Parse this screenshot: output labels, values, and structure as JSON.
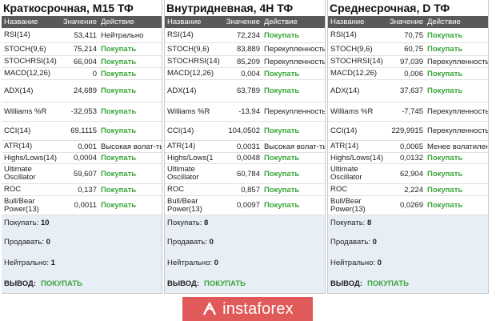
{
  "panels": [
    {
      "title": "Краткосрочная, M15 ТФ",
      "headers": [
        "Название",
        "Значение",
        "Действие"
      ],
      "rows": [
        {
          "name": "RSI(14)",
          "value": "53,411",
          "action": "Нейтрально",
          "buy": false
        },
        {
          "name": "STOCH(9,6)",
          "value": "75,214",
          "action": "Покупать",
          "buy": true
        },
        {
          "name": "STOCHRSI(14)",
          "value": "66,004",
          "action": "Покупать",
          "buy": true
        },
        {
          "name": "MACD(12,26)",
          "value": "0",
          "action": "Покупать",
          "buy": true
        },
        {
          "name": "ADX(14)",
          "value": "24,689",
          "action": "Покупать",
          "buy": true
        },
        {
          "name": "Williams %R",
          "value": "-32,053",
          "action": "Покупать",
          "buy": true
        },
        {
          "name": "CCI(14)",
          "value": "69,1115",
          "action": "Покупать",
          "buy": true
        },
        {
          "name": "ATR(14)",
          "value": "0,001",
          "action": "Высокая волат-ть",
          "buy": false
        },
        {
          "name": "Highs/Lows(14)",
          "value": "0,0004",
          "action": "Покупать",
          "buy": true
        },
        {
          "name": "Ultimate Oscillator",
          "value": "59,607",
          "action": "Покупать",
          "buy": true
        },
        {
          "name": "ROC",
          "value": "0,137",
          "action": "Покупать",
          "buy": true
        },
        {
          "name": "Bull/Bear Power(13)",
          "value": "0,0011",
          "action": "Покупать",
          "buy": true
        }
      ],
      "summary": {
        "buy_label": "Покупать:",
        "buy_count": "10",
        "sell_label": "Продавать:",
        "sell_count": "0",
        "neutral_label": "Нейтрально:",
        "neutral_count": "1",
        "verdict_label": "ВЫВОД:",
        "verdict": "ПОКУПАТЬ"
      }
    },
    {
      "title": "Внутридневная, 4Н ТФ",
      "headers": [
        "Название",
        "Значение",
        "Действие"
      ],
      "rows": [
        {
          "name": "RSI(14)",
          "value": "72,234",
          "action": "Покупать",
          "buy": true
        },
        {
          "name": "STOCH(9,6)",
          "value": "83,889",
          "action": "Перекупленность",
          "buy": false
        },
        {
          "name": "STOCHRSI(14)",
          "value": "85,209",
          "action": "Перекупленность",
          "buy": false
        },
        {
          "name": "MACD(12,26)",
          "value": "0,004",
          "action": "Покупать",
          "buy": true
        },
        {
          "name": "ADX(14)",
          "value": "63,789",
          "action": "Покупать",
          "buy": true
        },
        {
          "name": "Williams %R",
          "value": "-13,94",
          "action": "Перекупленность",
          "buy": false
        },
        {
          "name": "CCI(14)",
          "value": "104,0502",
          "action": "Покупать",
          "buy": true
        },
        {
          "name": "ATR(14)",
          "value": "0,0031",
          "action": "Высокая волат-ть",
          "buy": false
        },
        {
          "name": "Highs/Lows(1",
          "value": "0,0048",
          "action": "Покупать",
          "buy": true
        },
        {
          "name": "Ultimate Oscillator",
          "value": "60,784",
          "action": "Покупать",
          "buy": true
        },
        {
          "name": "ROC",
          "value": "0,857",
          "action": "Покупать",
          "buy": true
        },
        {
          "name": "Bull/Bear Power(13)",
          "value": "0,0097",
          "action": "Покупать",
          "buy": true
        }
      ],
      "summary": {
        "buy_label": "Покупать:",
        "buy_count": "8",
        "sell_label": "Продавать:",
        "sell_count": "0",
        "neutral_label": "Нейтрально:",
        "neutral_count": "0",
        "verdict_label": "ВЫВОД:",
        "verdict": "ПОКУПАТЬ"
      }
    },
    {
      "title": "Среднесрочная, D ТФ",
      "headers": [
        "Название",
        "Значение",
        "Действие"
      ],
      "rows": [
        {
          "name": "RSI(14)",
          "value": "70,75",
          "action": "Покупать",
          "buy": true
        },
        {
          "name": "STOCH(9,6)",
          "value": "60,75",
          "action": "Покупать",
          "buy": true
        },
        {
          "name": "STOCHRSI(14)",
          "value": "97,039",
          "action": "Перекупленность",
          "buy": false
        },
        {
          "name": "MACD(12,26)",
          "value": "0,006",
          "action": "Покупать",
          "buy": true
        },
        {
          "name": "ADX(14)",
          "value": "37,637",
          "action": "Покупать",
          "buy": true
        },
        {
          "name": "Williams %R",
          "value": "-7,745",
          "action": "Перекупленность",
          "buy": false
        },
        {
          "name": "CCI(14)",
          "value": "229,9915",
          "action": "Перекупленность",
          "buy": false
        },
        {
          "name": "ATR(14)",
          "value": "0,0065",
          "action": "Менее волатилен",
          "buy": false
        },
        {
          "name": "Highs/Lows(14)",
          "value": "0,0132",
          "action": "Покупать",
          "buy": true
        },
        {
          "name": "Ultimate Oscillator",
          "value": "62,904",
          "action": "Покупать",
          "buy": true
        },
        {
          "name": "ROC",
          "value": "2,224",
          "action": "Покупать",
          "buy": true
        },
        {
          "name": "Bull/Bear Power(13)",
          "value": "0,0269",
          "action": "Покупать",
          "buy": true
        }
      ],
      "summary": {
        "buy_label": "Покупать:",
        "buy_count": "8",
        "sell_label": "Продавать:",
        "sell_count": "0",
        "neutral_label": "Нейтрально:",
        "neutral_count": "0",
        "verdict_label": "ВЫВОД:",
        "verdict": "ПОКУПАТЬ"
      }
    }
  ],
  "logo": {
    "text": "instaforex",
    "icon": "instaforex-logo-icon",
    "background": "#e15a5a"
  },
  "colors": {
    "buy": "#3aa63a",
    "header_bg": "#595959",
    "summary_bg": "#e8eef6"
  }
}
